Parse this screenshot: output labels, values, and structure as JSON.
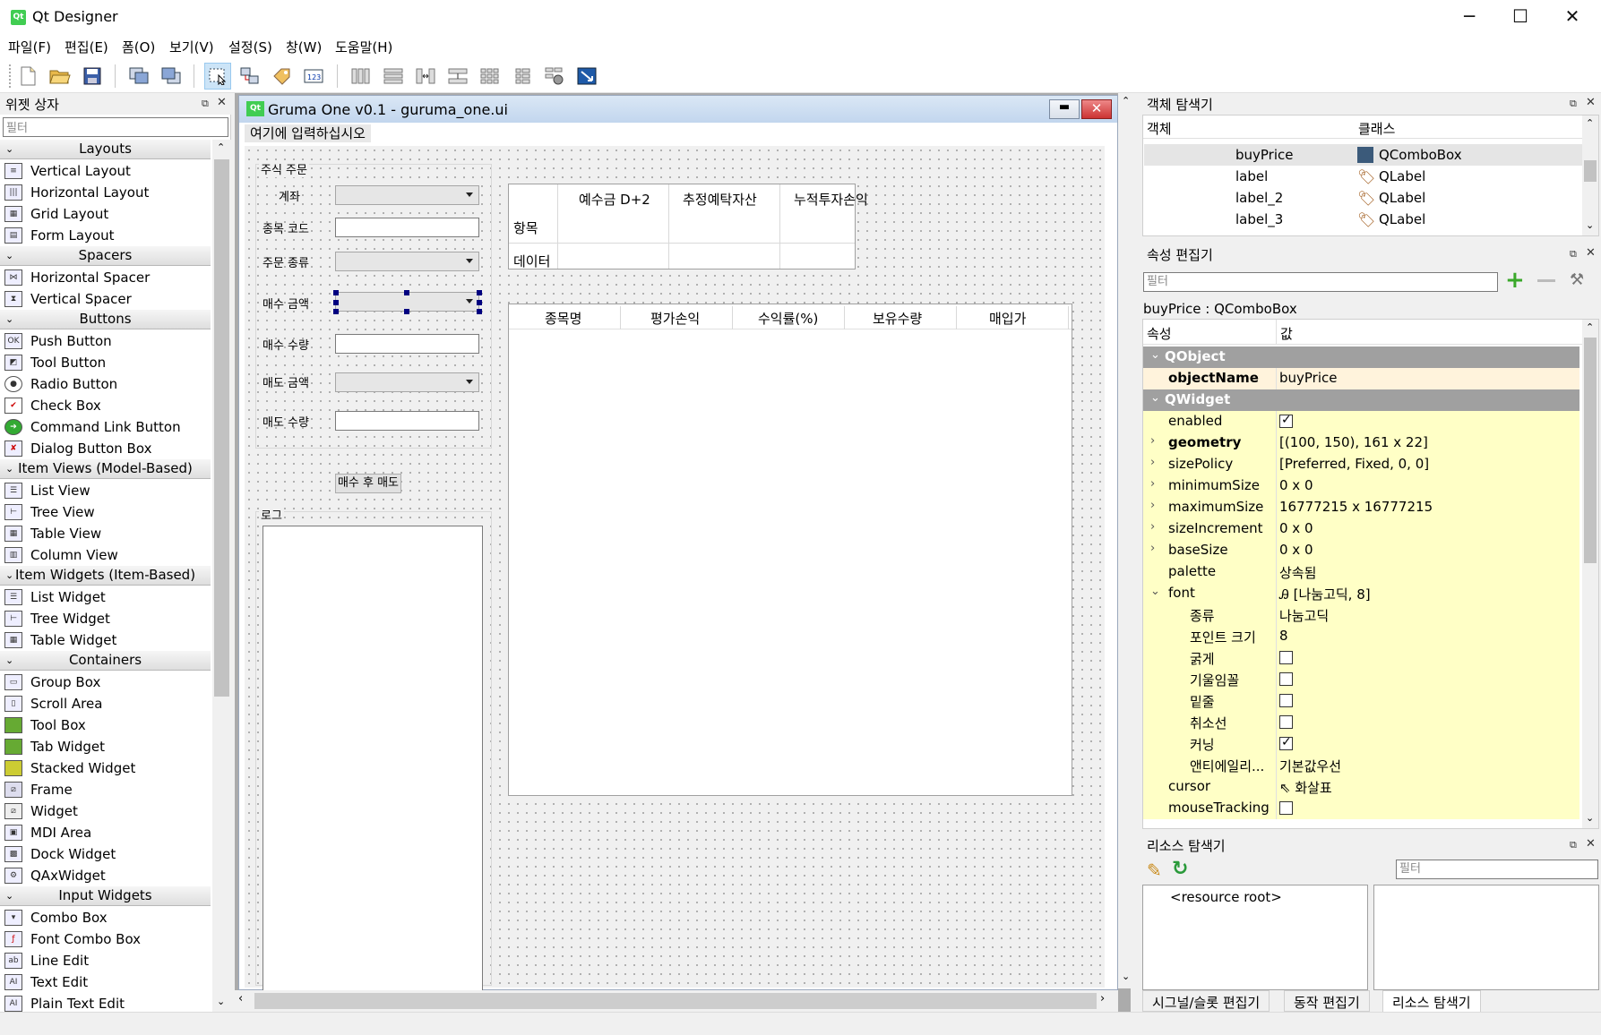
{
  "window": {
    "title": "Qt Designer",
    "controls": [
      "─",
      "☐",
      "✕"
    ]
  },
  "menu": [
    "파일(F)",
    "편집(E)",
    "폼(O)",
    "보기(V)",
    "설정(S)",
    "창(W)",
    "도움말(H)"
  ],
  "toolbar": {
    "icons": [
      "new-file-icon",
      "open-file-icon",
      "save-icon",
      "send-back-icon",
      "bring-front-icon",
      "edit-widgets-icon",
      "edit-signals-icon",
      "edit-buddies-icon",
      "edit-tab-order-icon",
      "layout-horizontal-icon",
      "layout-vertical-icon",
      "layout-h-splitter-icon",
      "layout-v-splitter-icon",
      "layout-grid-icon",
      "layout-form-icon",
      "break-layout-icon",
      "adjust-size-icon"
    ]
  },
  "widget_box": {
    "title": "위젯 상자",
    "filter_placeholder": "필터",
    "categories": [
      {
        "name": "Layouts",
        "items": [
          "Vertical Layout",
          "Horizontal Layout",
          "Grid Layout",
          "Form Layout"
        ]
      },
      {
        "name": "Spacers",
        "items": [
          "Horizontal Spacer",
          "Vertical Spacer"
        ]
      },
      {
        "name": "Buttons",
        "items": [
          "Push Button",
          "Tool Button",
          "Radio Button",
          "Check Box",
          "Command Link Button",
          "Dialog Button Box"
        ]
      },
      {
        "name": "Item Views (Model-Based)",
        "items": [
          "List View",
          "Tree View",
          "Table View",
          "Column View"
        ]
      },
      {
        "name": "Item Widgets (Item-Based)",
        "items": [
          "List Widget",
          "Tree Widget",
          "Table Widget"
        ]
      },
      {
        "name": "Containers",
        "items": [
          "Group Box",
          "Scroll Area",
          "Tool Box",
          "Tab Widget",
          "Stacked Widget",
          "Frame",
          "Widget",
          "MDI Area",
          "Dock Widget",
          "QAxWidget"
        ]
      },
      {
        "name": "Input Widgets",
        "items": [
          "Combo Box",
          "Font Combo Box",
          "Line Edit",
          "Text Edit",
          "Plain Text Edit"
        ]
      }
    ]
  },
  "form": {
    "title": "Gruma One v0.1 - guruma_one.ui",
    "menu_placeholder": "여기에 입력하십시오",
    "group_title": "주식 주문",
    "labels": {
      "account": "계좌",
      "code": "종목 코드",
      "order_type": "주문 종류",
      "buy_price": "매수 금액",
      "buy_qty": "매수 수량",
      "sell_price": "매도 금액",
      "sell_qty": "매도 수량"
    },
    "button": "매수 후 매도",
    "log_label": "로그",
    "summary_table": {
      "columns": [
        "예수금 D+2",
        "추정예탁자산",
        "누적투자손익"
      ],
      "rows": [
        "항목",
        "데이터"
      ]
    },
    "holdings_table": {
      "columns": [
        "종목명",
        "평가손익",
        "수익률(%)",
        "보유수량",
        "매입가"
      ]
    }
  },
  "object_inspector": {
    "title": "객체 탐색기",
    "col_object": "객체",
    "col_class": "클래스",
    "rows": [
      {
        "name": "buyPrice",
        "cls": "QComboBox"
      },
      {
        "name": "label",
        "cls": "QLabel"
      },
      {
        "name": "label_2",
        "cls": "QLabel"
      },
      {
        "name": "label_3",
        "cls": "QLabel"
      }
    ]
  },
  "property_editor": {
    "title": "속성 편집기",
    "filter_placeholder": "필터",
    "context": "buyPrice : QComboBox",
    "col_prop": "속성",
    "col_value": "값",
    "sections": [
      {
        "type": "section",
        "name": "QObject"
      },
      {
        "type": "row",
        "name": "objectName",
        "value": "buyPrice",
        "bold": true,
        "fill": "#fff3dc"
      },
      {
        "type": "section",
        "name": "QWidget"
      },
      {
        "type": "row",
        "name": "enabled",
        "check": true
      },
      {
        "type": "row",
        "name": "geometry",
        "value": "[(100, 150), 161 x 22]",
        "bold": true,
        "exp": "›"
      },
      {
        "type": "row",
        "name": "sizePolicy",
        "value": "[Preferred, Fixed, 0, 0]",
        "exp": "›"
      },
      {
        "type": "row",
        "name": "minimumSize",
        "value": "0 x 0",
        "exp": "›"
      },
      {
        "type": "row",
        "name": "maximumSize",
        "value": "16777215 x 16777215",
        "exp": "›"
      },
      {
        "type": "row",
        "name": "sizeIncrement",
        "value": "0 x 0",
        "exp": "›"
      },
      {
        "type": "row",
        "name": "baseSize",
        "value": "0 x 0",
        "exp": "›"
      },
      {
        "type": "row",
        "name": "palette",
        "value": "상속됨"
      },
      {
        "type": "row",
        "name": "font",
        "value": "Ꭿ [나눔고딕, 8]",
        "exp": "⌄"
      },
      {
        "type": "sub",
        "name": "종류",
        "value": "나눔고딕"
      },
      {
        "type": "sub",
        "name": "포인트 크기",
        "value": "8"
      },
      {
        "type": "sub",
        "name": "굵게",
        "check": false
      },
      {
        "type": "sub",
        "name": "기울임꼴",
        "check": false
      },
      {
        "type": "sub",
        "name": "밑줄",
        "check": false
      },
      {
        "type": "sub",
        "name": "취소선",
        "check": false
      },
      {
        "type": "sub",
        "name": "커닝",
        "check": true
      },
      {
        "type": "sub",
        "name": "앤티에일리...",
        "value": "기본값우선"
      },
      {
        "type": "row",
        "name": "cursor",
        "value": "⇖ 화살표"
      },
      {
        "type": "row",
        "name": "mouseTracking",
        "check": false
      }
    ]
  },
  "resource_browser": {
    "title": "리소스 탐색기",
    "filter_placeholder": "필터",
    "root": "<resource root>"
  },
  "bottom_tabs": [
    "시그널/슬롯 편집기",
    "동작 편집기",
    "리소스 탐색기"
  ],
  "colors": {
    "prop_fill": "#ffffc6",
    "section_fill": "#a0a0a0",
    "selected_row": "#e5e5e5",
    "form_title": "#c2d6ee"
  }
}
